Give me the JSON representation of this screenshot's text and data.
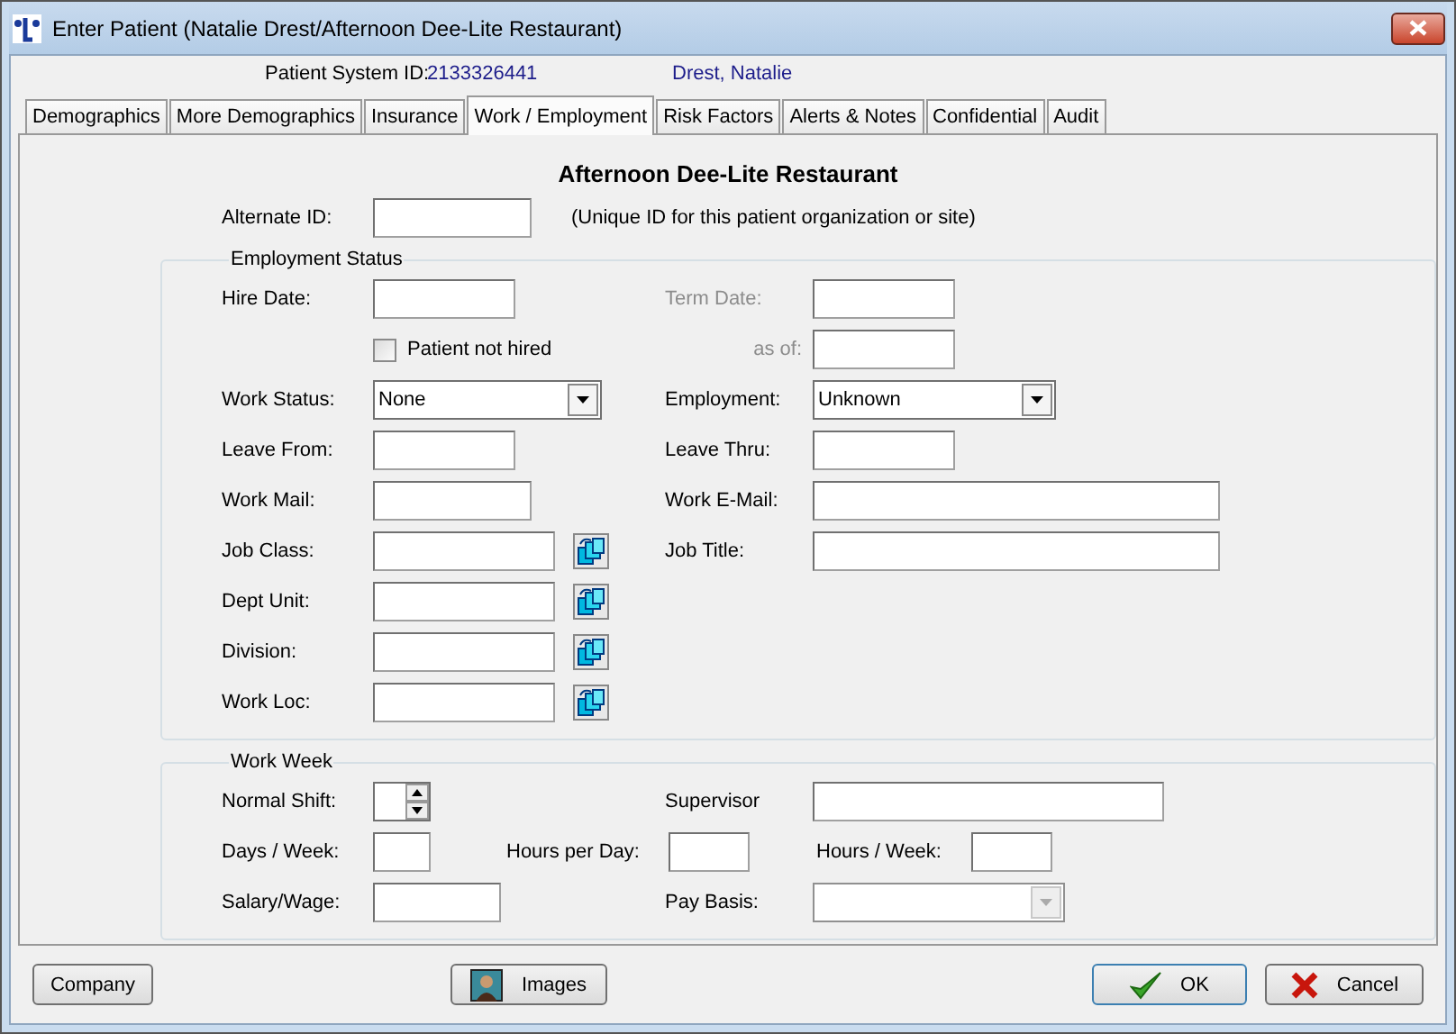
{
  "window": {
    "title": "Enter Patient (Natalie Drest/Afternoon Dee-Lite Restaurant)"
  },
  "header": {
    "label": "Patient System ID:",
    "id": "2133326441",
    "name": "Drest, Natalie"
  },
  "tabs": [
    {
      "label": "Demographics",
      "selected": false
    },
    {
      "label": "More Demographics",
      "selected": false
    },
    {
      "label": "Insurance",
      "selected": false
    },
    {
      "label": "Work / Employment",
      "selected": true
    },
    {
      "label": "Risk Factors",
      "selected": false
    },
    {
      "label": "Alerts & Notes",
      "selected": false
    },
    {
      "label": "Confidential",
      "selected": false
    },
    {
      "label": "Audit",
      "selected": false
    }
  ],
  "heading": "Afternoon Dee-Lite Restaurant",
  "alternate_id": {
    "label": "Alternate ID:",
    "note": "(Unique ID for this patient organization or site)"
  },
  "employment_status": {
    "title": "Employment Status",
    "rows": [
      [
        {
          "kind": "text",
          "label": "Hire Date:",
          "dimmed": false,
          "disabled": false
        },
        {
          "kind": "text",
          "label": "Term Date:",
          "dimmed": true,
          "disabled": false
        }
      ],
      [
        {
          "kind": "checkbox",
          "label": "Patient not hired",
          "checked": false,
          "dimmed": false,
          "disabled": false
        },
        {
          "kind": "text",
          "label": "as of:",
          "dimmed": true,
          "disabled": false
        }
      ],
      [
        {
          "kind": "combo",
          "label": "Work Status:",
          "value": "None",
          "dimmed": false,
          "disabled": false
        },
        {
          "kind": "combo",
          "label": "Employment:",
          "value": "Unknown",
          "dimmed": false,
          "disabled": false
        }
      ],
      [
        {
          "kind": "text",
          "label": "Leave From:",
          "dimmed": false,
          "disabled": false
        },
        {
          "kind": "text",
          "label": "Leave Thru:",
          "dimmed": false,
          "disabled": false
        }
      ],
      [
        {
          "kind": "text",
          "label": "Work Mail:",
          "dimmed": false,
          "disabled": false
        },
        {
          "kind": "text",
          "label": "Work E-Mail:",
          "dimmed": false,
          "disabled": false
        }
      ],
      [
        {
          "kind": "lookup",
          "label": "Job Class:",
          "dimmed": false,
          "disabled": false
        },
        {
          "kind": "text",
          "label": "Job Title:",
          "dimmed": false,
          "disabled": false
        }
      ],
      [
        {
          "kind": "lookup",
          "label": "Dept Unit:",
          "dimmed": false,
          "disabled": false
        }
      ],
      [
        {
          "kind": "lookup",
          "label": "Division:",
          "dimmed": false,
          "disabled": false
        }
      ],
      [
        {
          "kind": "lookup",
          "label": "Work Loc:",
          "dimmed": false,
          "disabled": false
        }
      ]
    ]
  },
  "work_week": {
    "title": "Work Week",
    "rows": [
      [
        {
          "kind": "spin",
          "label": "Normal Shift:",
          "dimmed": false,
          "disabled": false
        },
        {
          "kind": "text",
          "label": "Supervisor",
          "dimmed": false,
          "disabled": false
        }
      ],
      [
        {
          "kind": "text",
          "label": "Days / Week:",
          "dimmed": false,
          "disabled": false
        },
        {
          "kind": "text",
          "label": "Hours per Day:",
          "dimmed": false,
          "disabled": false
        },
        {
          "kind": "text",
          "label": "Hours / Week:",
          "dimmed": false,
          "disabled": false
        }
      ],
      [
        {
          "kind": "text",
          "label": "Salary/Wage:",
          "dimmed": false,
          "disabled": false
        },
        {
          "kind": "combo",
          "label": "Pay Basis:",
          "dimmed": false,
          "disabled": true
        }
      ]
    ]
  },
  "buttons": [
    {
      "kind": "company",
      "label": "Company"
    },
    {
      "kind": "images",
      "label": "Images"
    },
    {
      "kind": "ok",
      "label": "OK"
    },
    {
      "kind": "cancel",
      "label": "Cancel"
    }
  ]
}
